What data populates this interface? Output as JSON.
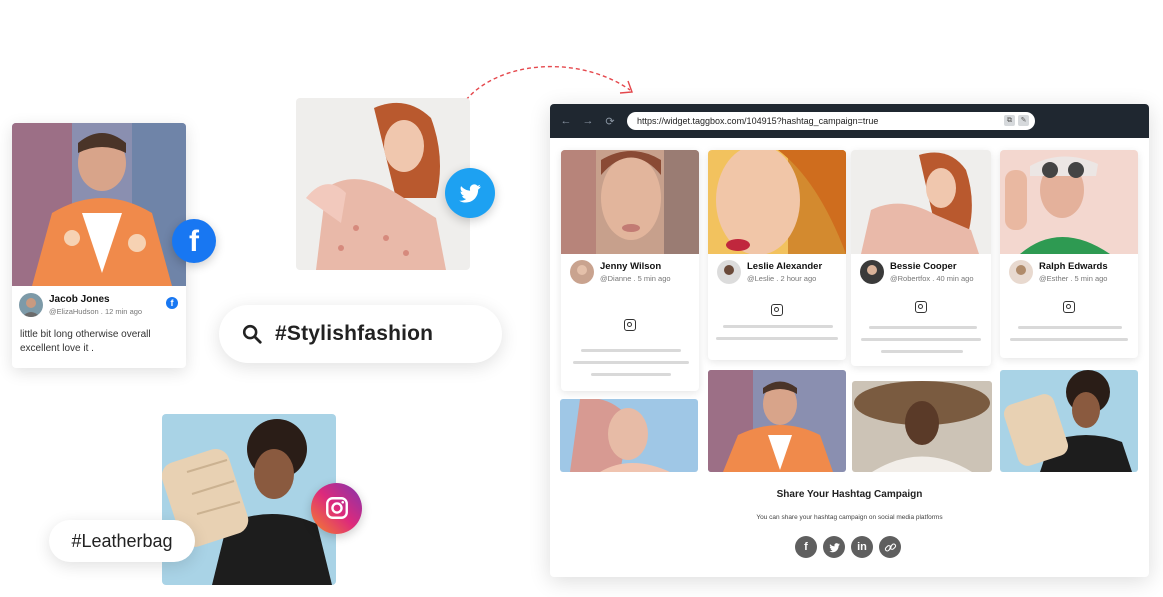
{
  "left_post": {
    "name": "Jacob Jones",
    "handle": "@ElizaHudson . 12 min ago",
    "text": "little bit long otherwise overall excellent love it .",
    "network_icon": "facebook-icon"
  },
  "search": {
    "query": "#Stylishfashion"
  },
  "tag": {
    "label": "#Leatherbag"
  },
  "browser": {
    "url": "https://widget.taggbox.com/104915?hashtag_campaign=true",
    "back_icon": "←",
    "forward_icon": "→",
    "reload_icon": "⟳"
  },
  "posts": [
    {
      "name": "Jenny Wilson",
      "handle": "@Dianne .  5 min ago"
    },
    {
      "name": "Leslie Alexander",
      "handle": "@Leslie . 2 hour ago"
    },
    {
      "name": "Bessie Cooper",
      "handle": "@Robertfox . 40 min ago"
    },
    {
      "name": "Ralph Edwards",
      "handle": "@Esther . 5 min ago"
    }
  ],
  "share": {
    "title": "Share Your Hashtag Campaign",
    "subtitle": "You can share your hashtag campaign on social media platforms",
    "icons": [
      "facebook-icon",
      "twitter-icon",
      "linkedin-icon",
      "link-icon"
    ]
  },
  "colors": {
    "facebook": "#1877f2",
    "twitter": "#1da1f2",
    "instagram_start": "#f58529",
    "instagram_end": "#8134af",
    "browser_bar": "#1f2730"
  }
}
